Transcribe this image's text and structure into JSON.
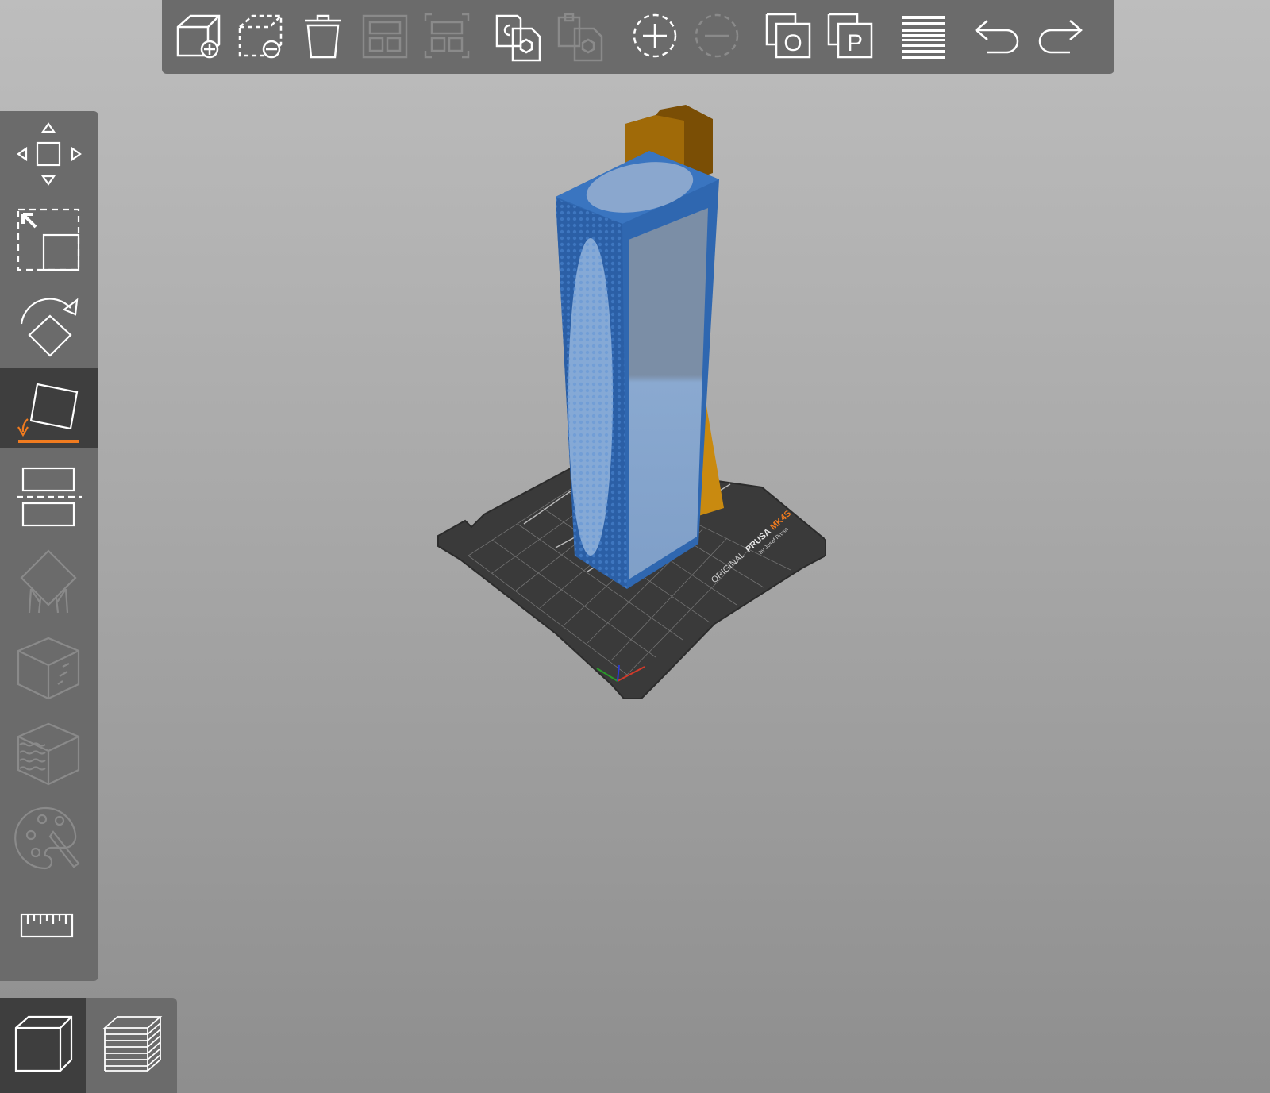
{
  "toolbar": {
    "items": [
      {
        "name": "add-object-icon",
        "label": "Add"
      },
      {
        "name": "delete-object-icon",
        "label": "Delete"
      },
      {
        "name": "delete-all-icon",
        "label": "Delete all"
      },
      {
        "name": "arrange-icon",
        "label": "Arrange"
      },
      {
        "name": "arrange-selection-icon",
        "label": "Arrange selection"
      },
      {
        "name": "copy-icon",
        "label": "Copy"
      },
      {
        "name": "paste-icon",
        "label": "Paste"
      },
      {
        "name": "add-instance-icon",
        "label": "Add instance"
      },
      {
        "name": "remove-instance-icon",
        "label": "Remove instance"
      },
      {
        "name": "split-to-objects-icon",
        "label": "Split to objects"
      },
      {
        "name": "split-to-parts-icon",
        "label": "Split to parts"
      },
      {
        "name": "variable-layer-height-icon",
        "label": "Variable layer height"
      },
      {
        "name": "undo-icon",
        "label": "Undo"
      },
      {
        "name": "redo-icon",
        "label": "Redo"
      }
    ],
    "split_objects_letter": "O",
    "split_parts_letter": "P"
  },
  "sidebar": {
    "items": [
      {
        "name": "move-tool-icon",
        "label": "Move",
        "active": false
      },
      {
        "name": "scale-tool-icon",
        "label": "Scale",
        "active": false
      },
      {
        "name": "rotate-tool-icon",
        "label": "Rotate",
        "active": false
      },
      {
        "name": "place-on-face-tool-icon",
        "label": "Place on face",
        "active": true
      },
      {
        "name": "cut-tool-icon",
        "label": "Cut",
        "active": false
      },
      {
        "name": "support-paint-tool-icon",
        "label": "Support painting",
        "active": false
      },
      {
        "name": "seam-paint-tool-icon",
        "label": "Seam painting",
        "active": false
      },
      {
        "name": "fuzzy-skin-tool-icon",
        "label": "Fuzzy skin",
        "active": false
      },
      {
        "name": "mmu-paint-tool-icon",
        "label": "Multimaterial painting",
        "active": false
      },
      {
        "name": "measure-tool-icon",
        "label": "Measure",
        "active": false
      }
    ],
    "active_accent": "#f07b1f"
  },
  "viewbar": {
    "items": [
      {
        "name": "3d-view-icon",
        "label": "3D editor view",
        "active": true
      },
      {
        "name": "preview-layers-icon",
        "label": "Preview",
        "active": false
      }
    ]
  },
  "scene": {
    "bed_brand_prefix": "ORIGINAL",
    "bed_brand_name": "PRUSA",
    "bed_brand_model": "MK4S",
    "bed_brand_sub": "by Josef Prusa",
    "object_color": "#2f67b0",
    "support_color": "#c98a10",
    "bed_color": "#3a3a3a"
  }
}
